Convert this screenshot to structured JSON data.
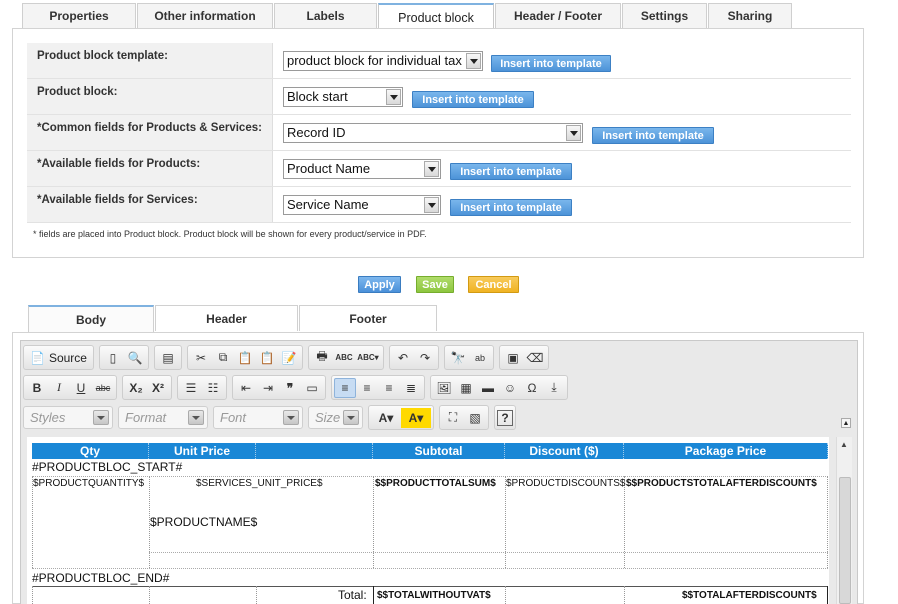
{
  "top_tabs": [
    "Properties",
    "Other information",
    "Labels",
    "Product block",
    "Header / Footer",
    "Settings",
    "Sharing"
  ],
  "active_tab": "Product block",
  "rows": [
    {
      "label": "Product block template:",
      "value": "product block for individual tax",
      "button": "Insert into template"
    },
    {
      "label": "Product block:",
      "value": "Block start",
      "button": "Insert into template"
    },
    {
      "label": "*Common fields for Products & Services:",
      "value": "Record ID",
      "button": "Insert into template"
    },
    {
      "label": "*Available fields for Products:",
      "value": "Product Name",
      "button": "Insert into template"
    },
    {
      "label": "*Available fields for Services:",
      "value": "Service Name",
      "button": "Insert into template"
    }
  ],
  "note": "* fields are placed into Product block. Product block will be shown for every product/service in PDF.",
  "actions": {
    "apply": "Apply",
    "save": "Save",
    "cancel": "Cancel"
  },
  "bottom_tabs": [
    "Body",
    "Header",
    "Footer"
  ],
  "toolbar": {
    "source_label": "Source",
    "styles": "Styles",
    "format": "Format",
    "font": "Font",
    "size": "Size"
  },
  "editor": {
    "headers": [
      "Qty",
      "Unit Price",
      "Subtotal",
      "Discount ($)",
      "Package Price"
    ],
    "bloc_start": "#PRODUCTBLOC_START#",
    "bloc_end": "#PRODUCTBLOC_END#",
    "quantity": "$PRODUCTQUANTITY$",
    "unit_price": "$SERVICES_UNIT_PRICE$",
    "total_sum": "$$PRODUCTTOTALSUM$",
    "discounts": "$PRODUCTDISCOUNTS$",
    "after_discount": "$$PRODUCTSTOTALAFTERDISCOUNT$",
    "product_name": "$PRODUCTNAME$",
    "total_label": "Total:",
    "total_without_vat": "$$TOTALWITHOUTVAT$",
    "total_after_discount": "$$TOTALAFTERDISCOUNT$"
  },
  "colors": {
    "insert_button": "#4c93d8",
    "apply": "#4a90d9",
    "save": "#8dc63f",
    "cancel": "#f0b323",
    "table_header": "#1a87d6"
  }
}
